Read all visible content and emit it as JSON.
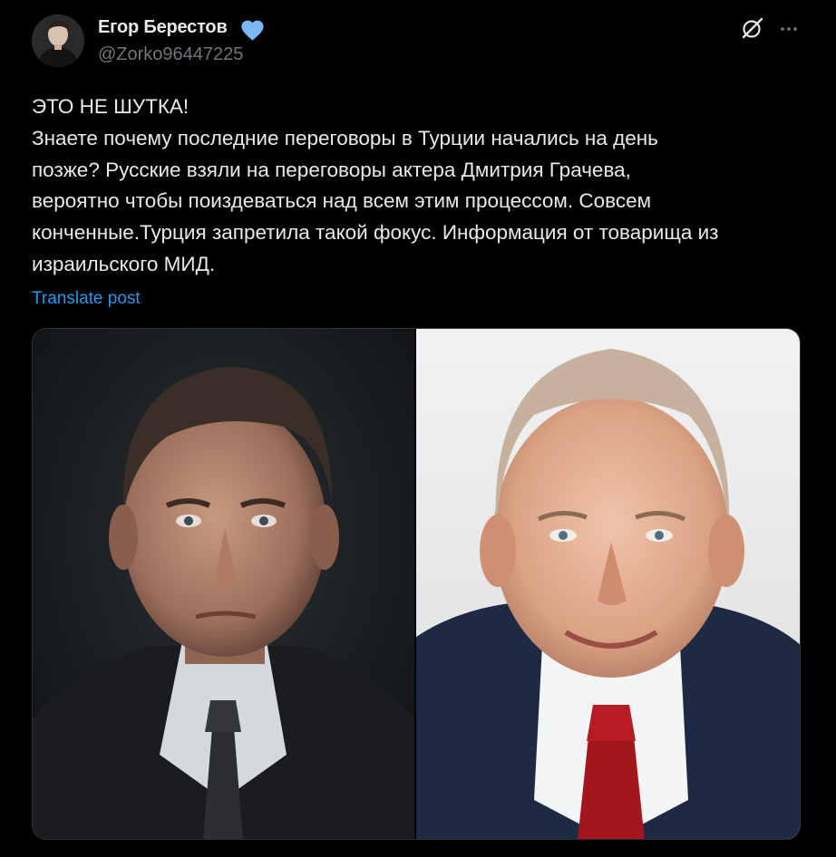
{
  "author": {
    "display_name": "Егор Берестов",
    "handle": "@Zorko96447225",
    "verified": true,
    "avatar_icon": "user-avatar"
  },
  "actions": {
    "grok_icon": "grok-icon",
    "more_icon": "more-dots-icon"
  },
  "post": {
    "lines": [
      "ЭТО НЕ ШУТКА!",
      "Знаете почему последние переговоры в Турции начались на день",
      "позже? Русские взяли на переговоры актера Дмитрия Грачева,",
      "вероятно чтобы поиздеваться над всем этим процессом. Совсем",
      "конченные.Турция запретила такой фокус. Информация от товарища из",
      "израильского МИД."
    ],
    "translate_label": "Translate post"
  },
  "media": {
    "images": [
      "portrait-photo-left",
      "portrait-photo-right"
    ]
  },
  "colors": {
    "background": "#000000",
    "text": "#e7e9ea",
    "secondary_text": "#71767b",
    "link": "#1d9bf0",
    "verified_badge": "#7ab8f5"
  }
}
